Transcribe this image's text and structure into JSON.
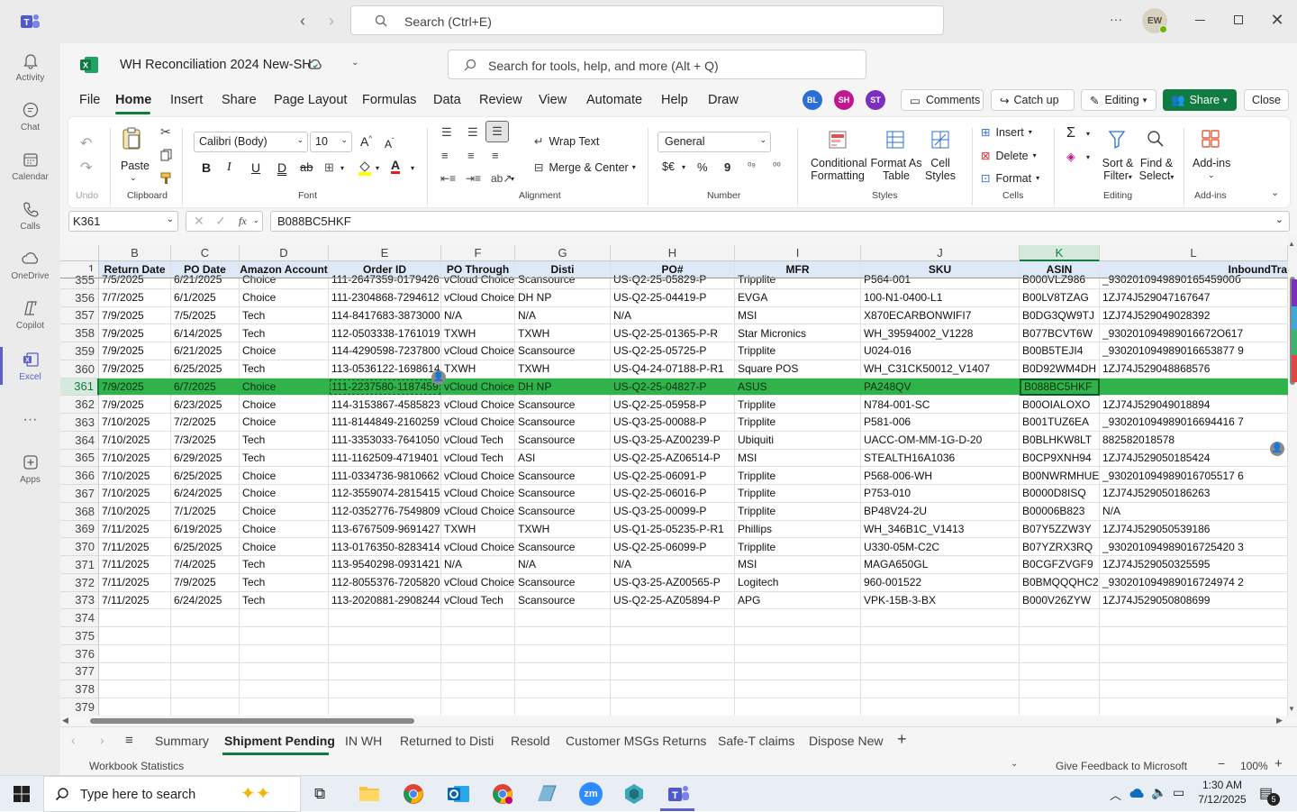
{
  "topbar": {
    "search_placeholder": "Search (Ctrl+E)",
    "more": "···",
    "avatar": "EW"
  },
  "rail": [
    {
      "label": "Activity",
      "icon": "bell-icon"
    },
    {
      "label": "Chat",
      "icon": "chat-icon"
    },
    {
      "label": "Calendar",
      "icon": "calendar-icon"
    },
    {
      "label": "Calls",
      "icon": "phone-icon"
    },
    {
      "label": "OneDrive",
      "icon": "cloud-icon"
    },
    {
      "label": "Copilot",
      "icon": "copilot-icon"
    },
    {
      "label": "Excel",
      "icon": "excel-icon",
      "active": true
    },
    {
      "label": "···",
      "icon": "more-icon"
    },
    {
      "label": "Apps",
      "icon": "apps-icon"
    }
  ],
  "workbook": {
    "title": "WH Reconciliation 2024 New-SH",
    "search_placeholder": "Search for tools, help, and more (Alt + Q)"
  },
  "menu": [
    "File",
    "Home",
    "Insert",
    "Share",
    "Page Layout",
    "Formulas",
    "Data",
    "Review",
    "View",
    "Automate",
    "Help",
    "Draw"
  ],
  "collab": [
    {
      "initials": "BL",
      "color": "#2b6fd6"
    },
    {
      "initials": "SH",
      "color": "#c0198f"
    },
    {
      "initials": "ST",
      "color": "#7b2fbd"
    }
  ],
  "actions": {
    "comments": "Comments",
    "catchup": "Catch up",
    "editing": "Editing",
    "share": "Share",
    "close": "Close"
  },
  "ribbon": {
    "undo_label": "Undo",
    "paste": "Paste",
    "clipboard": "Clipboard",
    "font_name": "Calibri (Body)",
    "font_size": "10",
    "font": "Font",
    "wrap": "Wrap Text",
    "merge": "Merge & Center",
    "alignment": "Alignment",
    "number_format": "General",
    "number": "Number",
    "currency": "$€",
    "percent": "%",
    "comma": "9",
    "cond1": "Conditional",
    "cond2": "Formatting",
    "fmt1": "Format As",
    "fmt2": "Table",
    "cs1": "Cell",
    "cs2": "Styles",
    "styles": "Styles",
    "insert": "Insert",
    "delete": "Delete",
    "format": "Format",
    "cells": "Cells",
    "sort1": "Sort &",
    "sort2": "Filter",
    "find1": "Find &",
    "find2": "Select",
    "editing": "Editing",
    "addins": "Add-ins",
    "addins_group": "Add-ins"
  },
  "namebox": "K361",
  "formula": "B088BC5HKF",
  "columns": [
    {
      "letter": "B",
      "header": "Return Date"
    },
    {
      "letter": "C",
      "header": "PO Date"
    },
    {
      "letter": "D",
      "header": "Amazon Account"
    },
    {
      "letter": "E",
      "header": "Order ID"
    },
    {
      "letter": "F",
      "header": "PO Through"
    },
    {
      "letter": "G",
      "header": "Disti"
    },
    {
      "letter": "H",
      "header": "PO#"
    },
    {
      "letter": "I",
      "header": "MFR"
    },
    {
      "letter": "J",
      "header": "SKU"
    },
    {
      "letter": "K",
      "header": "ASIN"
    },
    {
      "letter": "L",
      "header": "InboundTra"
    }
  ],
  "header_row": "1",
  "rows": [
    {
      "n": "355",
      "c": [
        "7/5/2025",
        "6/21/2025",
        "Choice",
        "111-2647359-0179426",
        "vCloud Choice",
        "Scansource",
        "US-Q2-25-05829-P",
        "Tripplite",
        "P564-001",
        "B000VLZ986",
        "_930201094989016545900б"
      ]
    },
    {
      "n": "356",
      "c": [
        "7/7/2025",
        "6/1/2025",
        "Choice",
        "111-2304868-7294612",
        "vCloud Choice",
        "DH NP",
        "US-Q2-25-04419-P",
        "EVGA",
        "100-N1-0400-L1",
        "B00LV8TZAG",
        "1ZJ74J529047167647"
      ]
    },
    {
      "n": "357",
      "c": [
        "7/9/2025",
        "7/5/2025",
        "Tech",
        "114-8417683-3873000",
        "N/A",
        "N/A",
        "N/A",
        "MSI",
        "X870ECARBONWIFI7",
        "B0DG3QW9TJ",
        "1ZJ74J529049028392"
      ]
    },
    {
      "n": "358",
      "c": [
        "7/9/2025",
        "6/14/2025",
        "Tech",
        "112-0503338-1761019",
        "TXWH",
        "TXWH",
        "US-Q2-25-01365-P-R",
        "Star Micronics",
        "WH_39594002_V1228",
        "B077BCVT6W",
        "_930201094989016672O617"
      ]
    },
    {
      "n": "359",
      "c": [
        "7/9/2025",
        "6/21/2025",
        "Choice",
        "114-4290598-7237800",
        "vCloud Choice",
        "Scansource",
        "US-Q2-25-05725-P",
        "Tripplite",
        "U024-016",
        "B00B5TEJI4",
        "_930201094989016653877 9"
      ]
    },
    {
      "n": "360",
      "c": [
        "7/9/2025",
        "6/25/2025",
        "Tech",
        "113-0536122-1698614",
        "TXWH",
        "TXWH",
        "US-Q4-24-07188-P-R1",
        "Square POS",
        "WH_C31CK50012_V1407",
        "B0D92WM4DH",
        "1ZJ74J529048868576"
      ]
    },
    {
      "n": "361",
      "c": [
        "7/9/2025",
        "6/7/2025",
        "Choice",
        "111-2237580-1187459",
        "vCloud Choice",
        "DH NP",
        "US-Q2-25-04827-P",
        "ASUS",
        "PA248QV",
        "B088BC5HKF",
        ""
      ]
    },
    {
      "n": "362",
      "c": [
        "7/9/2025",
        "6/23/2025",
        "Choice",
        "114-3153867-4585823",
        "vCloud Choice",
        "Scansource",
        "US-Q2-25-05958-P",
        "Tripplite",
        "N784-001-SC",
        "B00OIALOXO",
        "1ZJ74J529049018894"
      ]
    },
    {
      "n": "363",
      "c": [
        "7/10/2025",
        "7/2/2025",
        "Choice",
        "111-8144849-2160259",
        "vCloud Choice",
        "Scansource",
        "US-Q3-25-00088-P",
        "Tripplite",
        "P581-006",
        "B001TUZ6EA",
        "_930201094989016694416 7"
      ]
    },
    {
      "n": "364",
      "c": [
        "7/10/2025",
        "7/3/2025",
        "Tech",
        "111-3353033-7641050",
        "vCloud Tech",
        "Scansource",
        "US-Q3-25-AZ00239-P",
        "Ubiquiti",
        "UACC-OM-MM-1G-D-20",
        "B0BLHKW8LT",
        "882582018578"
      ]
    },
    {
      "n": "365",
      "c": [
        "7/10/2025",
        "6/29/2025",
        "Tech",
        "111-1162509-4719401",
        "vCloud Tech",
        "ASI",
        "US-Q2-25-AZ06514-P",
        "MSI",
        "STEALTH16A1036",
        "B0CP9XNH94",
        "1ZJ74J529050185424"
      ]
    },
    {
      "n": "366",
      "c": [
        "7/10/2025",
        "6/25/2025",
        "Choice",
        "111-0334736-9810662",
        "vCloud Choice",
        "Scansource",
        "US-Q2-25-06091-P",
        "Tripplite",
        "P568-006-WH",
        "B00NWRMHUE",
        "_930201094989016705517 6"
      ]
    },
    {
      "n": "367",
      "c": [
        "7/10/2025",
        "6/24/2025",
        "Choice",
        "112-3559074-2815415",
        "vCloud Choice",
        "Scansource",
        "US-Q2-25-06016-P",
        "Tripplite",
        "P753-010",
        "B0000D8ISQ",
        "1ZJ74J529050186263"
      ]
    },
    {
      "n": "368",
      "c": [
        "7/10/2025",
        "7/1/2025",
        "Choice",
        "112-0352776-7549809",
        "vCloud Choice",
        "Scansource",
        "US-Q3-25-00099-P",
        "Tripplite",
        "BP48V24-2U",
        "B00006B823",
        "N/A"
      ]
    },
    {
      "n": "369",
      "c": [
        "7/11/2025",
        "6/19/2025",
        "Choice",
        "113-6767509-9691427",
        "TXWH",
        "TXWH",
        "US-Q1-25-05235-P-R1",
        "Phillips",
        "WH_346B1C_V1413",
        "B07Y5ZZW3Y",
        "1ZJ74J529050539186"
      ]
    },
    {
      "n": "370",
      "c": [
        "7/11/2025",
        "6/25/2025",
        "Choice",
        "113-0176350-8283414",
        "vCloud Choice",
        "Scansource",
        "US-Q2-25-06099-P",
        "Tripplite",
        "U330-05M-C2C",
        "B07YZRX3RQ",
        "_930201094989016725420 3"
      ]
    },
    {
      "n": "371",
      "c": [
        "7/11/2025",
        "7/4/2025",
        "Tech",
        "113-9540298-0931421",
        "N/A",
        "N/A",
        "N/A",
        "MSI",
        "MAGA650GL",
        "B0CGFZVGF9",
        "1ZJ74J529050325595"
      ]
    },
    {
      "n": "372",
      "c": [
        "7/11/2025",
        "7/9/2025",
        "Tech",
        "112-8055376-7205820",
        "vCloud Choice",
        "Scansource",
        "US-Q3-25-AZ00565-P",
        "Logitech",
        "960-001522",
        "B0BMQQQHC2",
        "_930201094989016724974 2"
      ]
    },
    {
      "n": "373",
      "c": [
        "7/11/2025",
        "6/24/2025",
        "Tech",
        "113-2020881-2908244",
        "vCloud Tech",
        "Scansource",
        "US-Q2-25-AZ05894-P",
        "APG",
        "VPK-15B-3-BX",
        "B000V26ZYW",
        "1ZJ74J529050808699"
      ]
    },
    {
      "n": "374",
      "c": [
        "",
        "",
        "",
        "",
        "",
        "",
        "",
        "",
        "",
        "",
        ""
      ]
    },
    {
      "n": "375",
      "c": [
        "",
        "",
        "",
        "",
        "",
        "",
        "",
        "",
        "",
        "",
        ""
      ]
    },
    {
      "n": "376",
      "c": [
        "",
        "",
        "",
        "",
        "",
        "",
        "",
        "",
        "",
        "",
        ""
      ]
    },
    {
      "n": "377",
      "c": [
        "",
        "",
        "",
        "",
        "",
        "",
        "",
        "",
        "",
        "",
        ""
      ]
    },
    {
      "n": "378",
      "c": [
        "",
        "",
        "",
        "",
        "",
        "",
        "",
        "",
        "",
        "",
        ""
      ]
    },
    {
      "n": "379",
      "c": [
        "",
        "",
        "",
        "",
        "",
        "",
        "",
        "",
        "",
        "",
        ""
      ]
    }
  ],
  "selected_row": "361",
  "sheets": [
    "Summary",
    "Shipment Pending",
    "IN WH",
    "Returned to Disti",
    "Resold",
    "Customer MSGs Returns",
    "Safe-T claims",
    "Dispose New"
  ],
  "active_sheet": "Shipment Pending",
  "status": {
    "left": "Workbook Statistics",
    "feedback": "Give Feedback to Microsoft",
    "zoom": "100%"
  },
  "taskbar": {
    "search": "Type here to search",
    "time": "1:30 AM",
    "date": "7/12/2025",
    "notif": "5"
  }
}
